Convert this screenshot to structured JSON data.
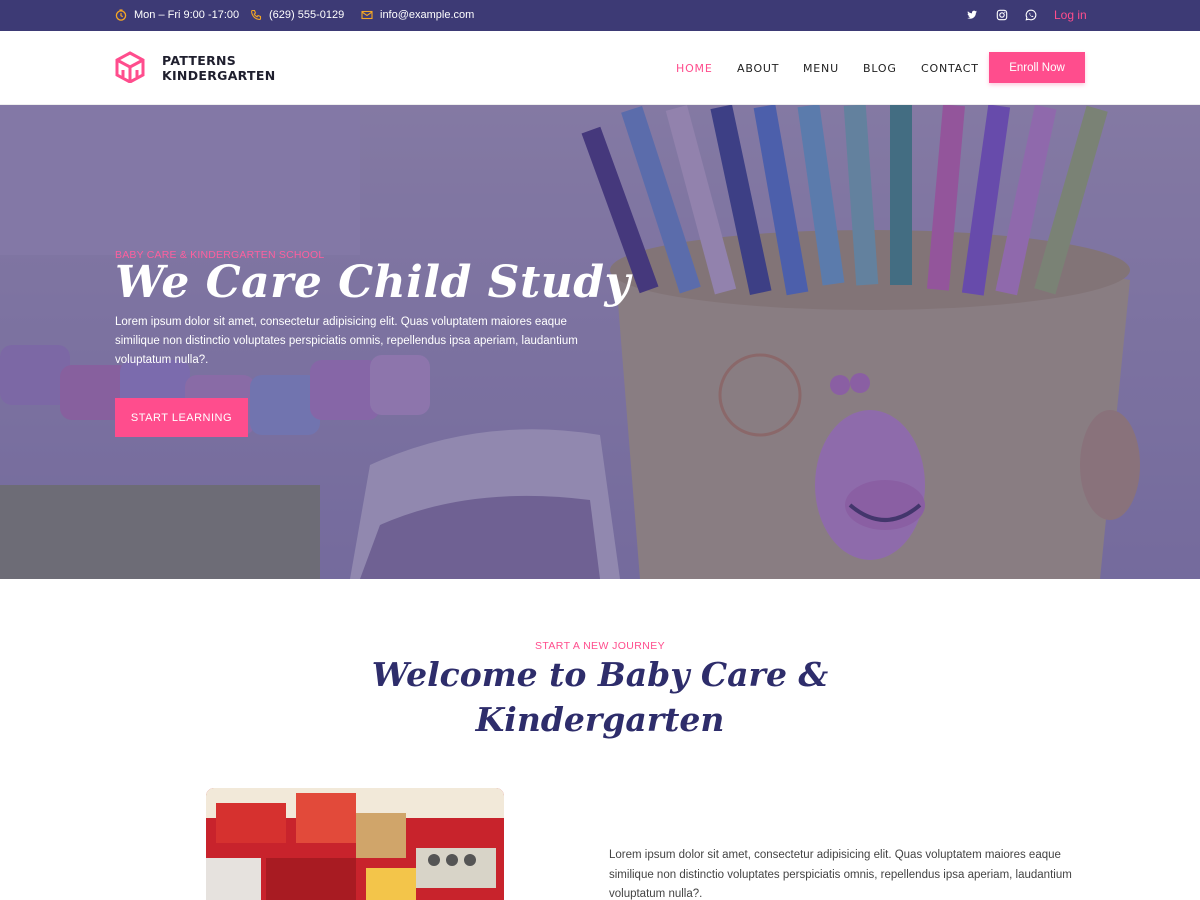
{
  "topbar": {
    "hours": "Mon – Fri 9:00 -17:00",
    "phone": "(629) 555-0129",
    "email": "info@example.com",
    "social": [
      "twitter-icon",
      "instagram-icon",
      "whatsapp-icon"
    ],
    "login": "Log in"
  },
  "header": {
    "logo_line1": "PATTERNS",
    "logo_line2": "KINDERGARTEN",
    "nav": [
      "HOME",
      "ABOUT",
      "MENU",
      "BLOG",
      "CONTACT"
    ],
    "active_nav": "HOME",
    "enroll": "Enroll Now"
  },
  "hero": {
    "eyebrow": "BABY CARE & KINDERGARTEN SCHOOL",
    "title": "We Care Child Study",
    "text": "Lorem ipsum dolor sit amet, consectetur adipisicing elit. Quas voluptatem maiores eaque similique non distinctio voluptates perspiciatis omnis, repellendus ipsa aperiam, laudantium voluptatum nulla?.",
    "button": "START LEARNING"
  },
  "welcome": {
    "eyebrow": "START A NEW JOURNEY",
    "title": "Welcome to Baby Care & Kindergarten",
    "text": "Lorem ipsum dolor sit amet, consectetur adipisicing elit. Quas voluptatem maiores eaque similique non distinctio voluptates perspiciatis omnis, repellendus ipsa aperiam, laudantium voluptatum nulla?."
  },
  "colors": {
    "topbar": "#3d3a75",
    "accent": "#ff4d8d",
    "heading": "#2e2d6b",
    "hero_overlay": "#4a4088"
  }
}
